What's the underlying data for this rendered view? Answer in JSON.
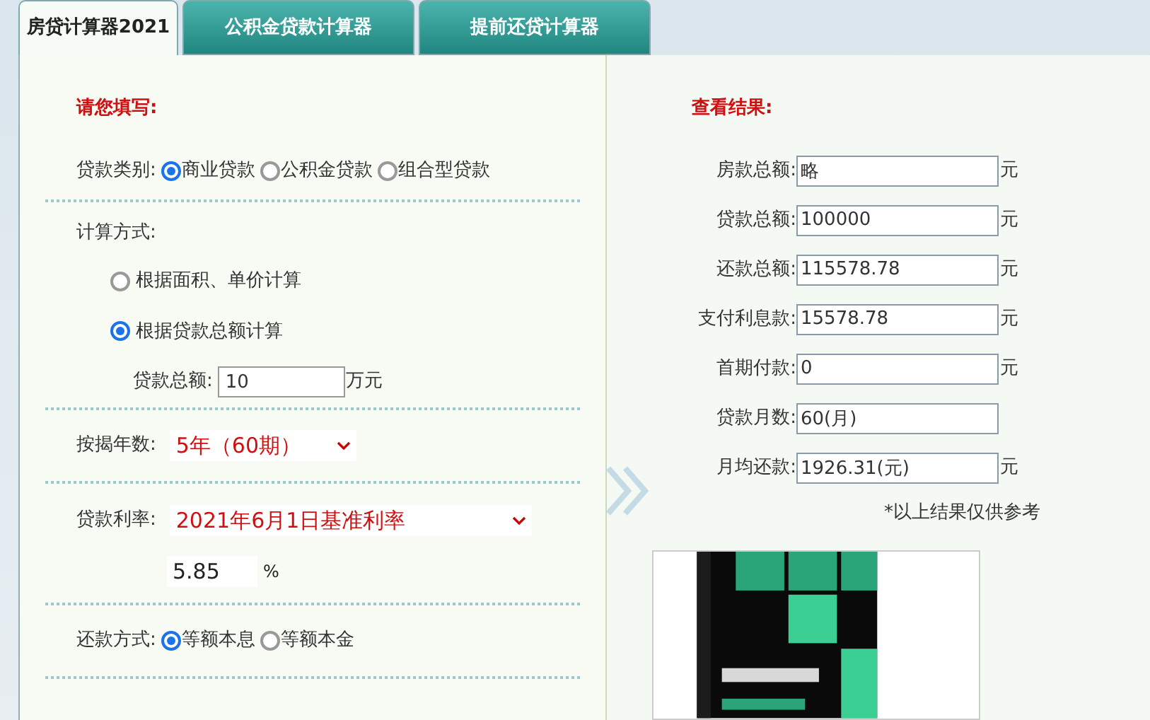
{
  "tabs": [
    {
      "label": "房贷计算器2021",
      "selected": true
    },
    {
      "label": "公积金贷款计算器",
      "selected": false
    },
    {
      "label": "提前还贷计算器",
      "selected": false
    }
  ],
  "form": {
    "heading": "请您填写:",
    "loan_type": {
      "label": "贷款类别:",
      "options": [
        {
          "label": "商业贷款",
          "selected": true
        },
        {
          "label": "公积金贷款",
          "selected": false
        },
        {
          "label": "组合型贷款",
          "selected": false
        }
      ]
    },
    "method": {
      "label": "计算方式:",
      "options": [
        {
          "label": "根据面积、单价计算",
          "selected": false
        },
        {
          "label": "根据贷款总额计算",
          "selected": true
        }
      ],
      "amount": {
        "label": "贷款总额:",
        "value": "10",
        "unit": "万元"
      }
    },
    "years": {
      "label": "按揭年数:",
      "value": "5年（60期）"
    },
    "rate": {
      "label": "贷款利率:",
      "value": "2021年6月1日基准利率",
      "percent_value": "5.85",
      "percent_unit": "%"
    },
    "repayment": {
      "label": "还款方式:",
      "options": [
        {
          "label": "等额本息",
          "selected": true
        },
        {
          "label": "等额本金",
          "selected": false
        }
      ]
    }
  },
  "results": {
    "heading": "查看结果:",
    "fields": [
      {
        "label": "房款总额:",
        "value": "略",
        "unit": "元"
      },
      {
        "label": "贷款总额:",
        "value": "100000",
        "unit": "元"
      },
      {
        "label": "还款总额:",
        "value": "115578.78",
        "unit": "元"
      },
      {
        "label": "支付利息款:",
        "value": "15578.78",
        "unit": "元"
      },
      {
        "label": "首期付款:",
        "value": "0",
        "unit": "元"
      },
      {
        "label": "贷款月数:",
        "value": "60(月)"
      },
      {
        "label": "月均还款:",
        "value": "1926.31(元)",
        "unit": "元"
      }
    ],
    "note": "*以上结果仅供参考"
  }
}
